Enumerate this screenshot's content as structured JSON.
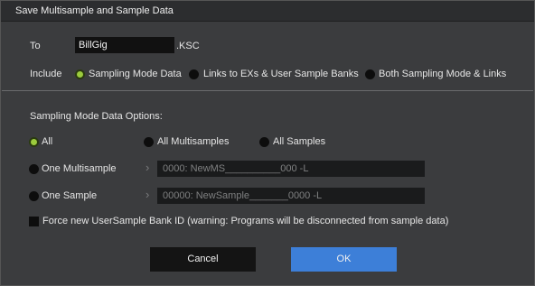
{
  "dialog": {
    "title": "Save Multisample and Sample Data"
  },
  "file": {
    "to_label": "To",
    "name": "BillGig",
    "extension": ".KSC"
  },
  "include": {
    "label": "Include",
    "options": [
      {
        "label": "Sampling Mode Data",
        "selected": true
      },
      {
        "label": "Links to EXs & User Sample Banks",
        "selected": false
      },
      {
        "label": "Both Sampling Mode & Links",
        "selected": false
      }
    ]
  },
  "sampling_options": {
    "heading": "Sampling Mode Data Options:",
    "all": {
      "label": "All",
      "selected": true
    },
    "all_multisamples": {
      "label": "All Multisamples",
      "selected": false
    },
    "all_samples": {
      "label": "All Samples",
      "selected": false
    },
    "one_multisample": {
      "label": "One Multisample",
      "selected": false,
      "value": "0000: NewMS__________000 -L"
    },
    "one_sample": {
      "label": "One Sample",
      "selected": false,
      "value": "00000: NewSample_______0000 -L"
    }
  },
  "force_new_bank": {
    "label": "Force new UserSample Bank ID (warning: Programs will be disconnected from sample data)",
    "checked": false
  },
  "buttons": {
    "cancel": "Cancel",
    "ok": "OK"
  },
  "colors": {
    "accent": "#9ccc3d",
    "ok_button": "#3d7fd8",
    "background": "#3b3c3e"
  }
}
